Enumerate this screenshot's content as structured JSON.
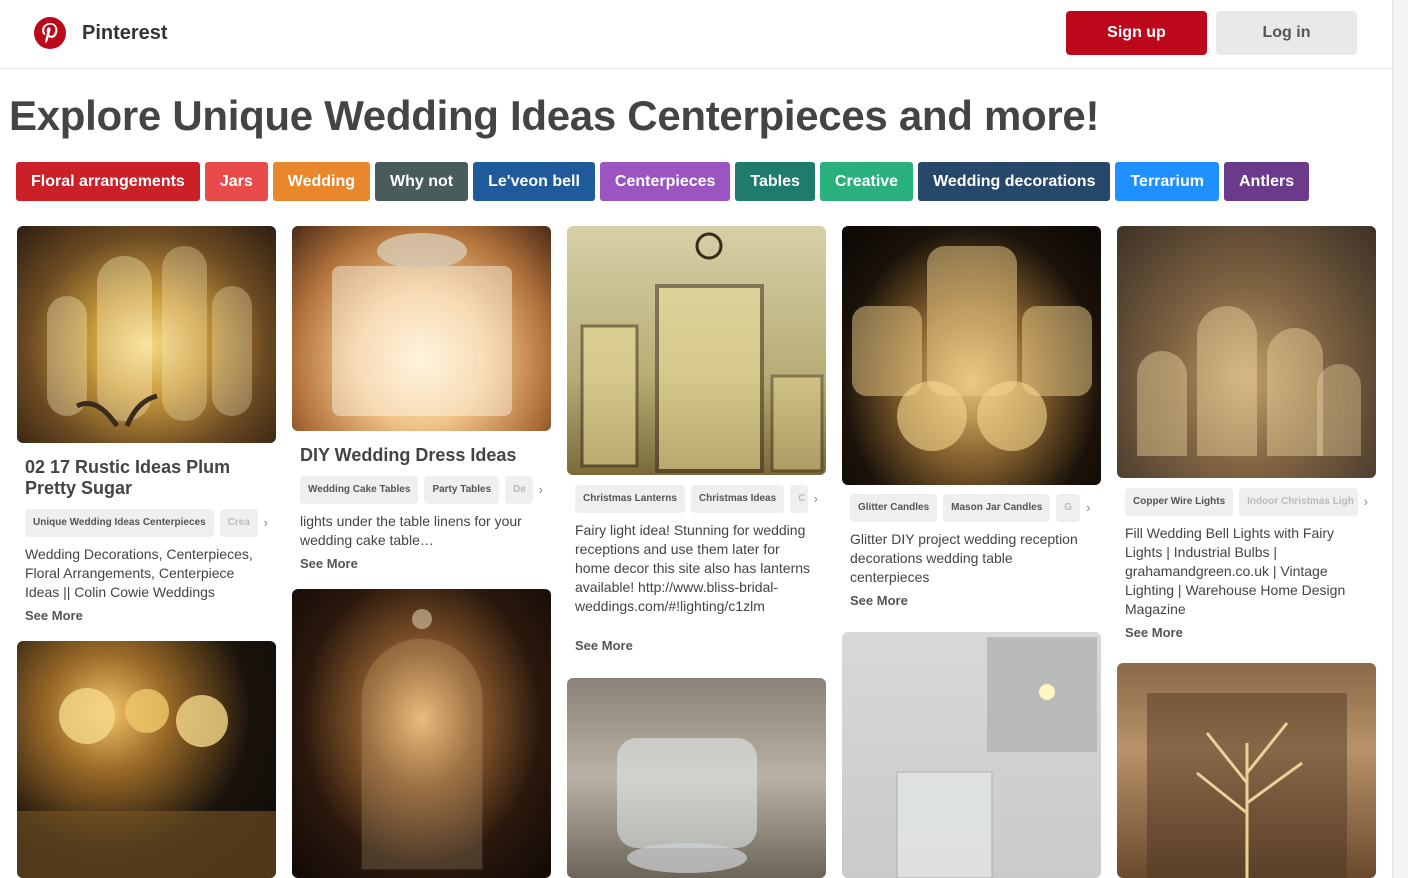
{
  "header": {
    "brand": "Pinterest",
    "signup_label": "Sign up",
    "login_label": "Log in",
    "brand_color": "#bd081c"
  },
  "page_title": "Explore Unique Wedding Ideas Centerpieces and more!",
  "chips": [
    {
      "label": "Floral arrangements",
      "color": "#cb2027"
    },
    {
      "label": "Jars",
      "color": "#e94b4b"
    },
    {
      "label": "Wedding",
      "color": "#e8872c"
    },
    {
      "label": "Why not",
      "color": "#4a5b5b"
    },
    {
      "label": "Le'veon bell",
      "color": "#1f5b9b"
    },
    {
      "label": "Centerpieces",
      "color": "#9b55c0"
    },
    {
      "label": "Tables",
      "color": "#1f7b6b"
    },
    {
      "label": "Creative",
      "color": "#2ab07e"
    },
    {
      "label": "Wedding decorations",
      "color": "#28486b"
    },
    {
      "label": "Terrarium",
      "color": "#1e90ff"
    },
    {
      "label": "Antlers",
      "color": "#6b3a8b"
    }
  ],
  "pins": [
    {
      "title": "02 17 Rustic Ideas Plum Pretty Sugar",
      "tags": [
        "Unique Wedding Ideas Centerpieces",
        "Crea"
      ],
      "description": "Wedding Decorations, Centerpieces, Floral Arrangements, Centerpiece Ideas || Colin Cowie Weddings",
      "see_more": "See More"
    },
    {
      "title": "DIY Wedding Dress Ideas",
      "tags": [
        "Wedding Cake Tables",
        "Party Tables",
        "De"
      ],
      "description": "lights under the table linens for your wedding cake table…",
      "see_more": "See More"
    },
    {
      "title": "",
      "tags": [
        "Christmas Lanterns",
        "Christmas Ideas",
        "C"
      ],
      "description": "Fairy light idea! Stunning for wedding receptions and use them later for home decor this site also has lanterns available! http://www.bliss-bridal-weddings.com/#!lighting/c1zlm",
      "see_more": "See More"
    },
    {
      "title": "",
      "tags": [
        "Glitter Candles",
        "Mason Jar Candles",
        "G"
      ],
      "description": "Glitter DIY project wedding reception decorations wedding table centerpieces",
      "see_more": "See More"
    },
    {
      "title": "",
      "tags": [
        "Copper Wire Lights",
        "Indoor Christmas Ligh"
      ],
      "description": "Fill Wedding Bell Lights with Fairy Lights | Industrial Bulbs | grahamandgreen.co.uk | Vintage Lighting | Warehouse Home Design Magazine",
      "see_more": "See More"
    }
  ]
}
